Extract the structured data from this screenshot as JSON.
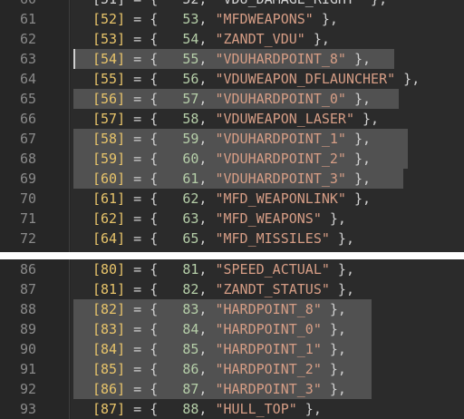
{
  "top_pane": {
    "partial_line": {
      "number": "60",
      "code": "[51] = {   52, \"VDU_DAMAGE_RIGHT\" },"
    },
    "lines": [
      {
        "number": "61",
        "index": "[52]",
        "value": "53",
        "name": "\"MFDWEAPONS\"",
        "highlighted": false
      },
      {
        "number": "62",
        "index": "[53]",
        "value": "54",
        "name": "\"ZANDT_VDU\"",
        "highlighted": false
      },
      {
        "number": "63",
        "index": "[54]",
        "value": "55",
        "name": "\"VDUHARDPOINT_8\"",
        "highlighted": true
      },
      {
        "number": "64",
        "index": "[55]",
        "value": "56",
        "name": "\"VDUWEAPON_DFLAUNCHER\"",
        "highlighted": false
      },
      {
        "number": "65",
        "index": "[56]",
        "value": "57",
        "name": "\"VDUHARDPOINT_0\"",
        "highlighted": true
      },
      {
        "number": "66",
        "index": "[57]",
        "value": "58",
        "name": "\"VDUWEAPON_LASER\"",
        "highlighted": false
      },
      {
        "number": "67",
        "index": "[58]",
        "value": "59",
        "name": "\"VDUHARDPOINT_1\"",
        "highlighted": true
      },
      {
        "number": "68",
        "index": "[59]",
        "value": "60",
        "name": "\"VDUHARDPOINT_2\"",
        "highlighted": true
      },
      {
        "number": "69",
        "index": "[60]",
        "value": "61",
        "name": "\"VDUHARDPOINT_3\"",
        "highlighted": true
      },
      {
        "number": "70",
        "index": "[61]",
        "value": "62",
        "name": "\"MFD_WEAPONLINK\"",
        "highlighted": false
      },
      {
        "number": "71",
        "index": "[62]",
        "value": "63",
        "name": "\"MFD_WEAPONS\"",
        "highlighted": false
      },
      {
        "number": "72",
        "index": "[64]",
        "value": "65",
        "name": "\"MFD_MISSILES\"",
        "highlighted": false
      }
    ]
  },
  "bottom_pane": {
    "lines": [
      {
        "number": "86",
        "index": "[80]",
        "value": "81",
        "name": "\"SPEED_ACTUAL\"",
        "highlighted": false
      },
      {
        "number": "87",
        "index": "[81]",
        "value": "82",
        "name": "\"ZANDT_STATUS\"",
        "highlighted": false
      },
      {
        "number": "88",
        "index": "[82]",
        "value": "83",
        "name": "\"HARDPOINT_8\"",
        "highlighted": true
      },
      {
        "number": "89",
        "index": "[83]",
        "value": "84",
        "name": "\"HARDPOINT_0\"",
        "highlighted": true
      },
      {
        "number": "90",
        "index": "[84]",
        "value": "85",
        "name": "\"HARDPOINT_1\"",
        "highlighted": true
      },
      {
        "number": "91",
        "index": "[85]",
        "value": "86",
        "name": "\"HARDPOINT_2\"",
        "highlighted": true
      },
      {
        "number": "92",
        "index": "[86]",
        "value": "87",
        "name": "\"HARDPOINT_3\"",
        "highlighted": true
      },
      {
        "number": "93",
        "index": "[87]",
        "value": "88",
        "name": "\"HULL_TOP\"",
        "highlighted": false
      }
    ]
  },
  "syntax": {
    "eq": " = {",
    "close": " },",
    "comma": ","
  }
}
